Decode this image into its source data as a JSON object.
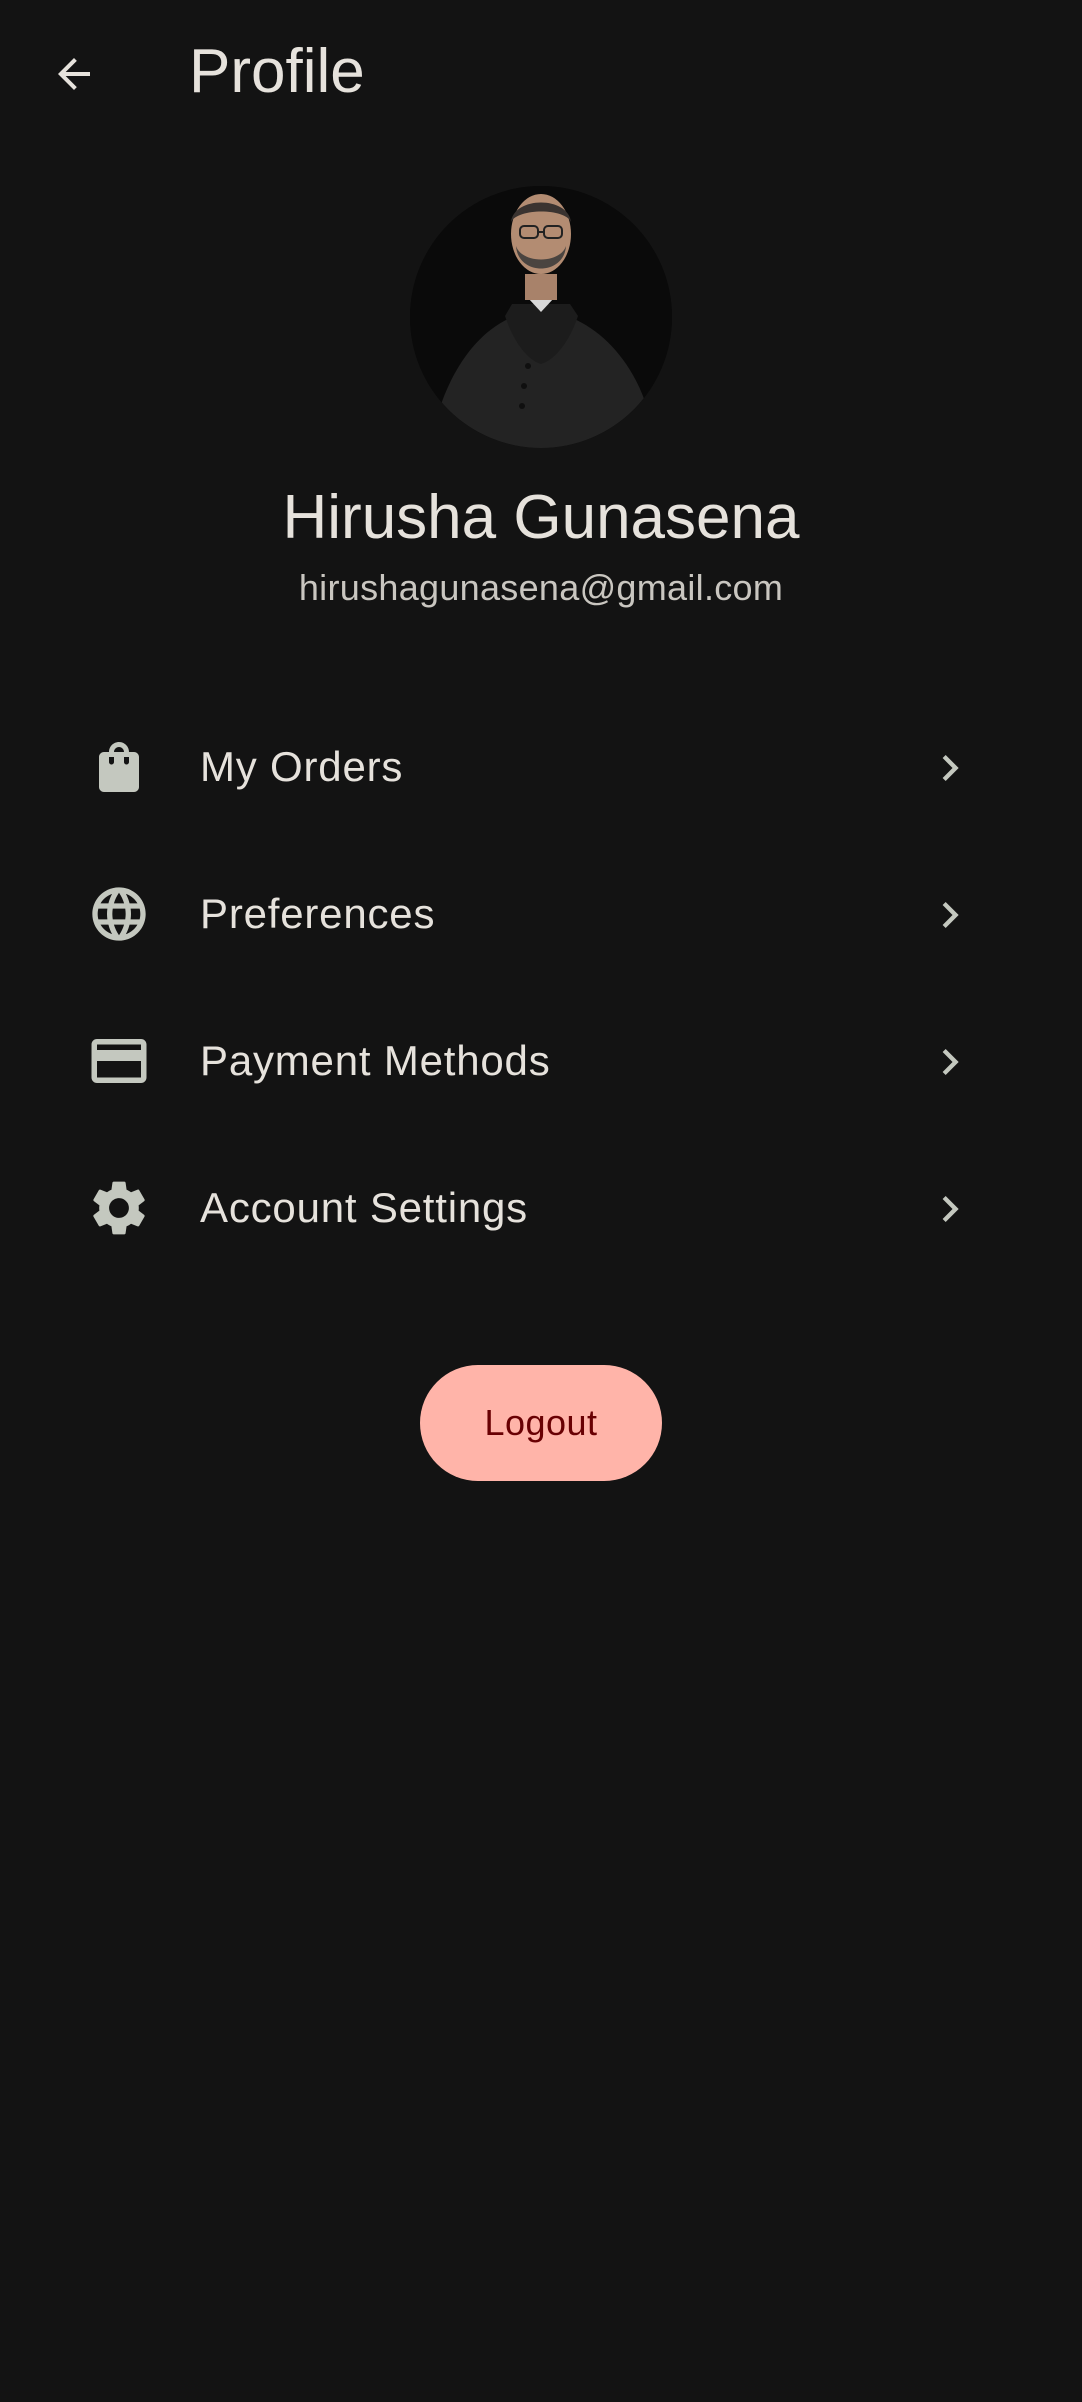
{
  "app_bar": {
    "back_icon": "arrow-back-icon",
    "title": "Profile"
  },
  "profile": {
    "name": "Hirusha Gunasena",
    "email": "hirushagunasena@gmail.com"
  },
  "menu": {
    "items": [
      {
        "label": "My Orders",
        "icon": "shopping-bag-icon"
      },
      {
        "label": "Preferences",
        "icon": "globe-icon"
      },
      {
        "label": "Payment Methods",
        "icon": "credit-card-icon"
      },
      {
        "label": "Account Settings",
        "icon": "gear-icon"
      }
    ],
    "chevron_icon": "chevron-right-icon"
  },
  "logout": {
    "label": "Logout"
  },
  "colors": {
    "background": "#131313",
    "text": "#e6e2dc",
    "icon": "#c4c8bf",
    "logout_bg": "#ffb4a9",
    "logout_text": "#690003"
  }
}
